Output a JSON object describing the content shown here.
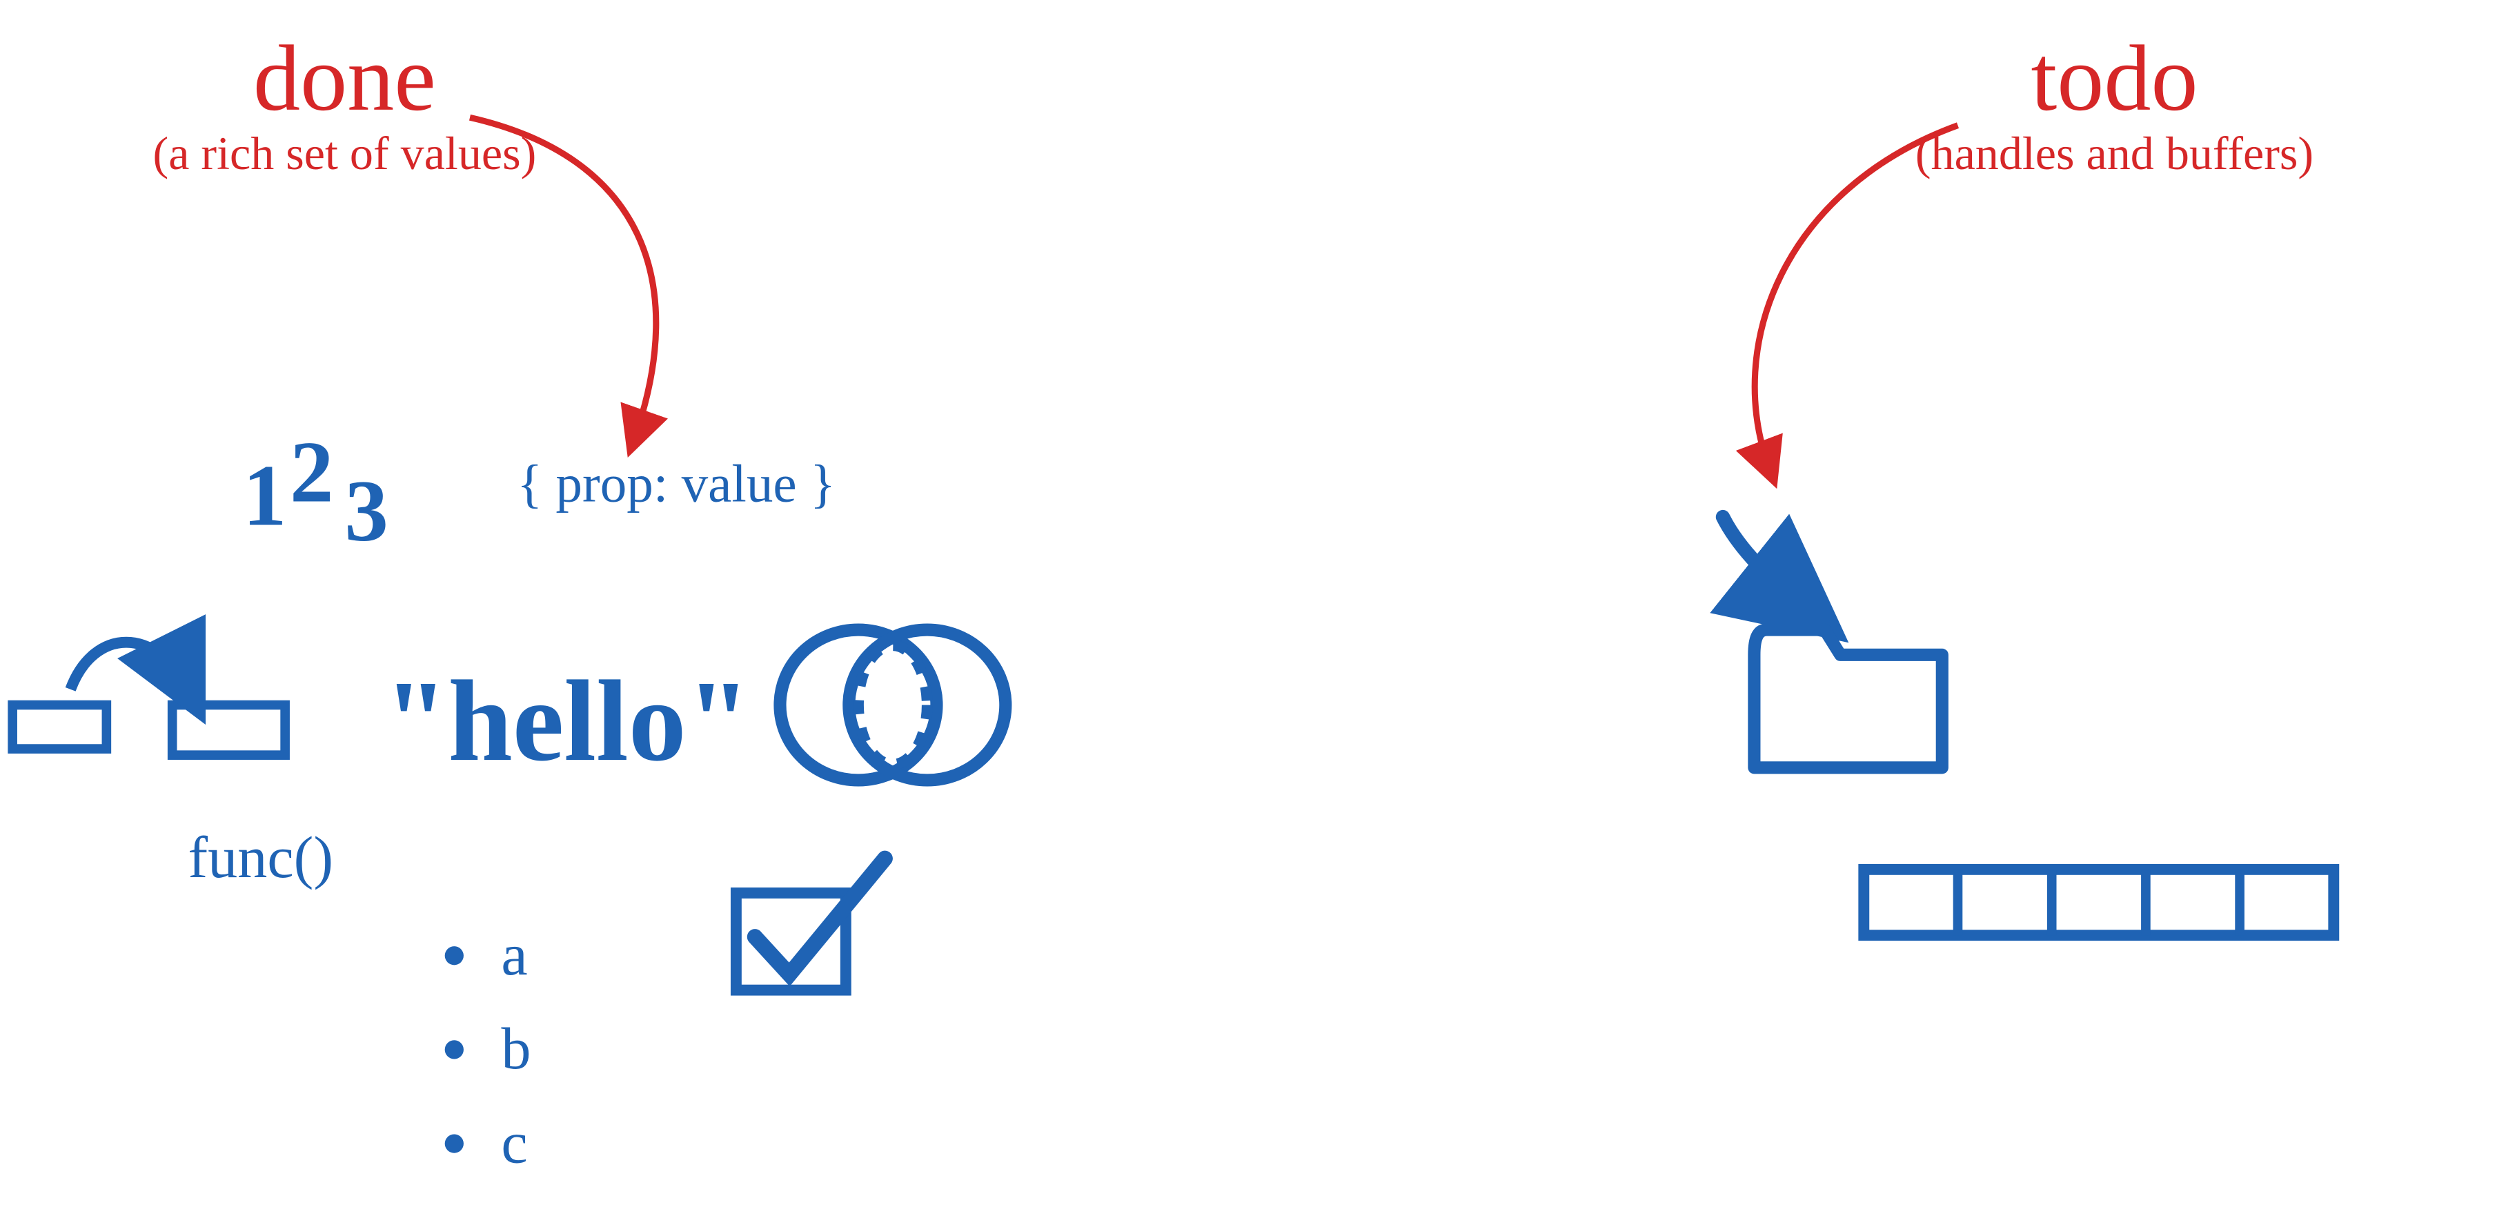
{
  "colors": {
    "red": "#d62728",
    "blue": "#1f63b4"
  },
  "left": {
    "title": "done",
    "subtitle": "(a rich set of values)",
    "numbers": {
      "n1": "1",
      "n2": "2",
      "n3": "3"
    },
    "object_literal": "{ prop: value }",
    "string_value": "\"hello\"",
    "func_label": "func()",
    "list": {
      "a": "a",
      "b": "b",
      "c": "c"
    }
  },
  "right": {
    "title": "todo",
    "subtitle": "(handles and buffers)"
  }
}
